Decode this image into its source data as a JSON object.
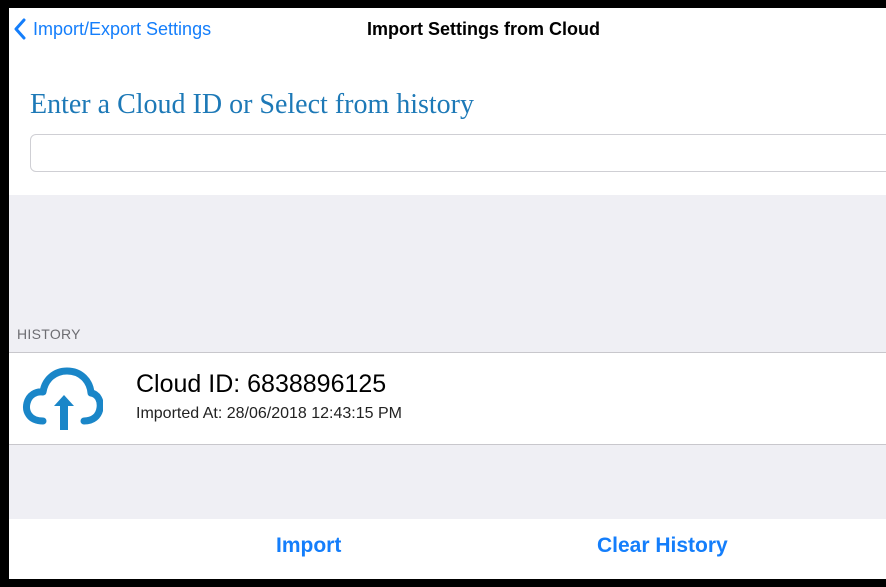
{
  "navbar": {
    "back_label": "Import/Export Settings",
    "title": "Import Settings from Cloud"
  },
  "prompt": {
    "text": "Enter a Cloud ID or Select from history"
  },
  "cloud_id_input": {
    "value": "",
    "placeholder": ""
  },
  "history": {
    "header": "HISTORY",
    "items": [
      {
        "icon": "cloud-upload-icon",
        "title": "Cloud ID: 6838896125",
        "subtitle": "Imported At: 28/06/2018 12:43:15 PM"
      }
    ]
  },
  "toolbar": {
    "import_label": "Import",
    "clear_label": "Clear History"
  },
  "colors": {
    "accent": "#147efb",
    "prompt_text": "#1d79b7",
    "grouped_background": "#efeff4",
    "cloud_icon": "#1a86c8"
  }
}
